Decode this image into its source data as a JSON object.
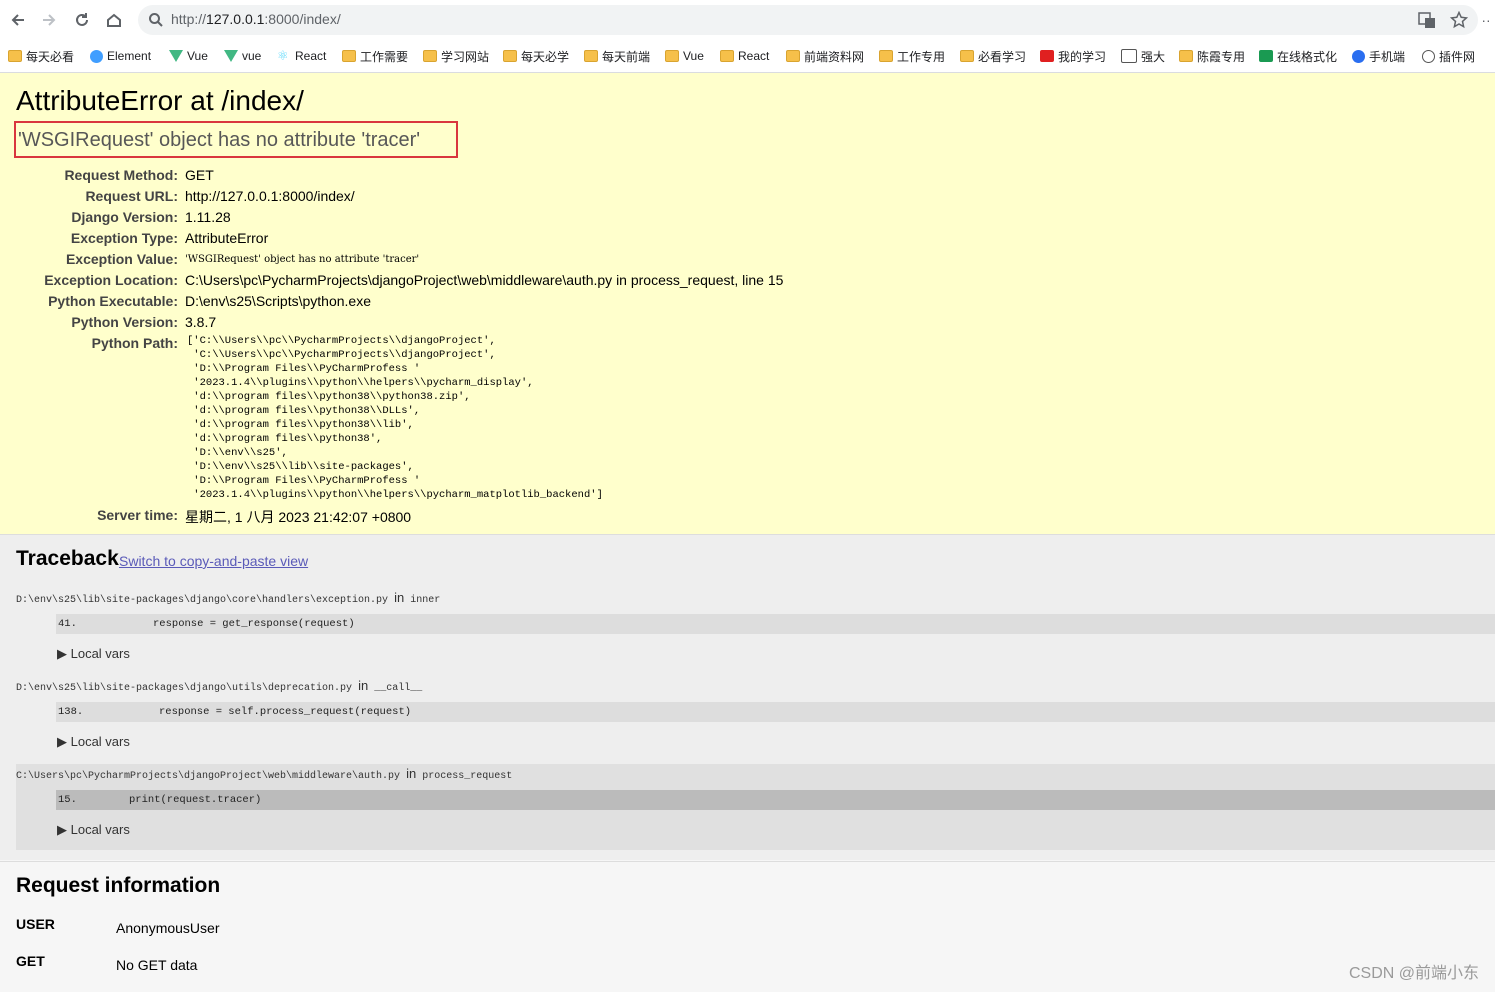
{
  "browser": {
    "url_prefix": "http://",
    "url_host": "127.0.0.1",
    "url_rest": ":8000/index/",
    "more_label": "··",
    "bookmarks": [
      {
        "label": "每天必看",
        "icon": "folder-icon"
      },
      {
        "label": "Element",
        "icon": "element-logo-icon"
      },
      {
        "label": "Vue",
        "icon": "vue-logo-icon"
      },
      {
        "label": "vue",
        "icon": "vue-logo-icon"
      },
      {
        "label": "React",
        "icon": "react-logo-icon"
      },
      {
        "label": "工作需要",
        "icon": "folder-icon"
      },
      {
        "label": "学习网站",
        "icon": "folder-icon"
      },
      {
        "label": "每天必学",
        "icon": "folder-icon"
      },
      {
        "label": "每天前端",
        "icon": "folder-icon"
      },
      {
        "label": "Vue",
        "icon": "folder-icon"
      },
      {
        "label": "React",
        "icon": "folder-icon"
      },
      {
        "label": "前端资料网",
        "icon": "folder-icon"
      },
      {
        "label": "工作专用",
        "icon": "folder-icon"
      },
      {
        "label": "必看学习",
        "icon": "folder-icon"
      },
      {
        "label": "我的学习",
        "icon": "red-bookmark-icon"
      },
      {
        "label": "强大",
        "icon": "search-box-icon"
      },
      {
        "label": "陈霞专用",
        "icon": "folder-icon"
      },
      {
        "label": "在线格式化",
        "icon": "green-t-icon"
      },
      {
        "label": "手机端",
        "icon": "blue-check-icon"
      },
      {
        "label": "插件网",
        "icon": "globe-icon"
      }
    ]
  },
  "summary": {
    "title": "AttributeError at /index/",
    "exception_value": "'WSGIRequest' object has no attribute 'tracer'",
    "rows": [
      {
        "key": "Request Method:",
        "value": "GET"
      },
      {
        "key": "Request URL:",
        "value": "http://127.0.0.1:8000/index/"
      },
      {
        "key": "Django Version:",
        "value": "1.11.28"
      },
      {
        "key": "Exception Type:",
        "value": "AttributeError"
      },
      {
        "key": "Exception Value:",
        "value": "'WSGIRequest' object has no attribute 'tracer'"
      },
      {
        "key": "Exception Location:",
        "value": "C:\\Users\\pc\\PycharmProjects\\djangoProject\\web\\middleware\\auth.py in process_request, line 15"
      },
      {
        "key": "Python Executable:",
        "value": "D:\\env\\s25\\Scripts\\python.exe"
      },
      {
        "key": "Python Version:",
        "value": "3.8.7"
      },
      {
        "key": "Python Path:",
        "value": ""
      },
      {
        "key": "Server time:",
        "value": "星期二, 1 八月 2023 21:42:07 +0800"
      }
    ],
    "python_path": "['C:\\\\Users\\\\pc\\\\PycharmProjects\\\\djangoProject',\n 'C:\\\\Users\\\\pc\\\\PycharmProjects\\\\djangoProject',\n 'D:\\\\Program Files\\\\PyCharmProfess '\n '2023.1.4\\\\plugins\\\\python\\\\helpers\\\\pycharm_display',\n 'd:\\\\program files\\\\python38\\\\python38.zip',\n 'd:\\\\program files\\\\python38\\\\DLLs',\n 'd:\\\\program files\\\\python38\\\\lib',\n 'd:\\\\program files\\\\python38',\n 'D:\\\\env\\\\s25',\n 'D:\\\\env\\\\s25\\\\lib\\\\site-packages',\n 'D:\\\\Program Files\\\\PyCharmProfess '\n '2023.1.4\\\\plugins\\\\python\\\\helpers\\\\pycharm_matplotlib_backend']"
  },
  "traceback": {
    "title": "Traceback",
    "switch_link": "Switch to copy-and-paste view",
    "in_word": "in",
    "local_vars": "▶ Local vars",
    "frames": [
      {
        "file": "D:\\env\\s25\\lib\\site-packages\\django\\core\\handlers\\exception.py",
        "func": "inner",
        "line_no": "41.",
        "code": "response = get_response(request)"
      },
      {
        "file": "D:\\env\\s25\\lib\\site-packages\\django\\utils\\deprecation.py",
        "func": "__call__",
        "line_no": "138.",
        "code": "response = self.process_request(request)"
      },
      {
        "file": "C:\\Users\\pc\\PycharmProjects\\djangoProject\\web\\middleware\\auth.py",
        "func": "process_request",
        "line_no": "15.",
        "code": "print(request.tracer)"
      }
    ]
  },
  "request_info": {
    "title": "Request information",
    "rows": [
      {
        "key": "USER",
        "value": "AnonymousUser"
      },
      {
        "key": "GET",
        "value": "No GET data"
      }
    ]
  },
  "watermark": "CSDN @前端小东",
  "colors": {
    "summary_bg": "#ffffcc",
    "highlight_box": "#d9363e",
    "traceback_bg": "#eeeeee",
    "link": "#5a5ab8"
  }
}
